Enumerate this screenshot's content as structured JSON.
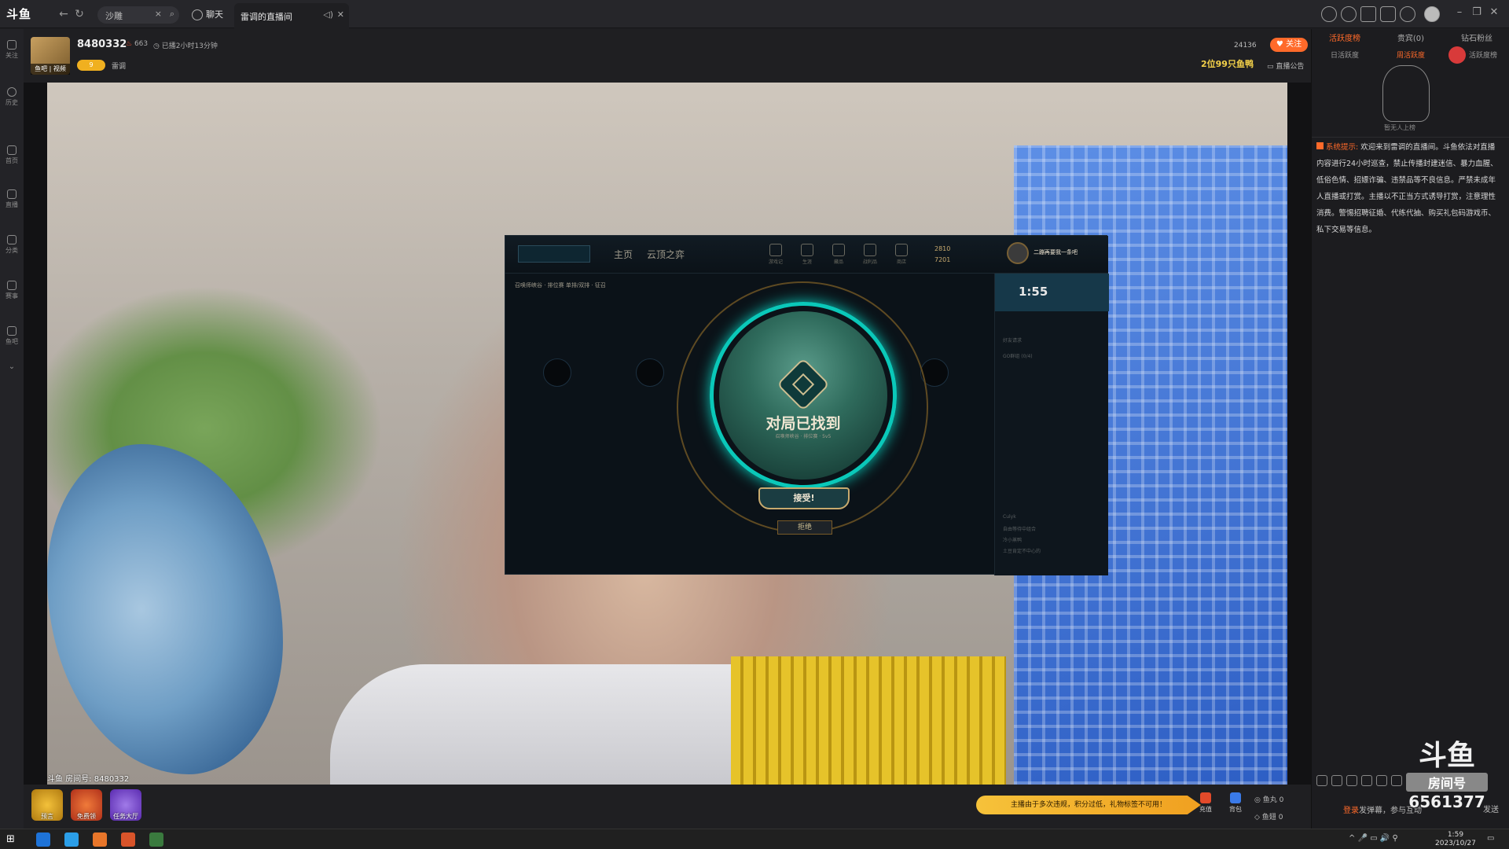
{
  "browser": {
    "logo": "斗鱼",
    "search_text": "沙雕",
    "chat_label": "聊天",
    "tab_label": "雷调的直播间"
  },
  "sidebar": {
    "items": [
      {
        "label": "关注",
        "icon": "heart-icon"
      },
      {
        "label": "历史",
        "icon": "clock-icon"
      },
      {
        "label": "首页",
        "icon": "home-icon"
      },
      {
        "label": "直播",
        "icon": "tv-icon"
      },
      {
        "label": "分类",
        "icon": "grid-icon"
      },
      {
        "label": "赛事",
        "icon": "trophy-icon"
      },
      {
        "label": "鱼吧",
        "icon": "fish-icon"
      }
    ]
  },
  "stream": {
    "room_name": "8480332",
    "heat": "663",
    "live_time": "已播2小时13分钟",
    "avatar_tag": "鱼吧 | 视频",
    "fans_badge": "9",
    "streamer": "雷调",
    "follow_count": "24136",
    "follow_label": "关注",
    "promo": "2位99只鱼鸭",
    "announce": "直播公告",
    "room_no_label": "斗鱼 房间号: 8480332"
  },
  "lol": {
    "nav_home": "主页",
    "nav_tft": "云顶之弈",
    "icons": [
      "游戏记",
      "生涯",
      "藏品",
      "战利品",
      "商店"
    ],
    "be": "2810",
    "rp": "7201",
    "profile_name": "二蹦再要我一条吧",
    "queue_bar": "召唤师峡谷 · 排位赛 单排/双排 · 征召",
    "queue_time": "1:55",
    "friends": [
      "好友请求",
      "GO群组 (0/4)",
      "Culyk",
      "自由等待中组合",
      "冷小蒸鸭",
      "土豆肯定不中心的"
    ],
    "match_found": "对局已找到",
    "match_sub": "召唤师峡谷 · 排位赛 · 5v5",
    "accept": "接受!",
    "decline": "拒绝"
  },
  "bottom": {
    "icons": [
      {
        "label": "预言",
        "color": "#d89a1e"
      },
      {
        "label": "免费领",
        "color": "#e34a2a"
      },
      {
        "label": "任务大厅",
        "color": "#7c4ad8"
      }
    ],
    "notice": "主播由于多次违规，积分过低，礼物标签不可用！",
    "recharge": "充值",
    "bag": "背包",
    "fish_ball": "鱼丸",
    "fish_ball_count": "0",
    "fish_wing": "鱼翅",
    "fish_wing_count": "0"
  },
  "rightpanel": {
    "tabs": [
      "活跃度榜",
      "贵宾(0)",
      "钻石粉丝"
    ],
    "subtabs": [
      "日活跃度",
      "周活跃度",
      "活跃度榜"
    ],
    "empty_text": "暂无人上榜",
    "sys_tag": "系统提示:",
    "sys_msg": "欢迎来到雷调的直播间。斗鱼依法对直播内容进行24小时巡查，禁止传播封建迷信、暴力血腥、低俗色情、招嫖诈骗、违禁品等不良信息。严禁未成年人直播或打赏。主播以不正当方式诱导打赏，注意理性消费。警惕招聘征婚、代练代抽、购买礼包码游戏币、私下交易等信息。",
    "login": "登录",
    "login_rest": "发弹幕，参与互动",
    "send": "发送",
    "watermark_top": "斗鱼",
    "watermark_mid": "房间号",
    "watermark_num": "6561377"
  },
  "taskbar": {
    "time": "1:59",
    "date": "2023/10/27",
    "apps": [
      "#1e73d8",
      "#2b9ee8",
      "#e8762a",
      "#d8542a",
      "#3a7a3e",
      "#222"
    ]
  }
}
